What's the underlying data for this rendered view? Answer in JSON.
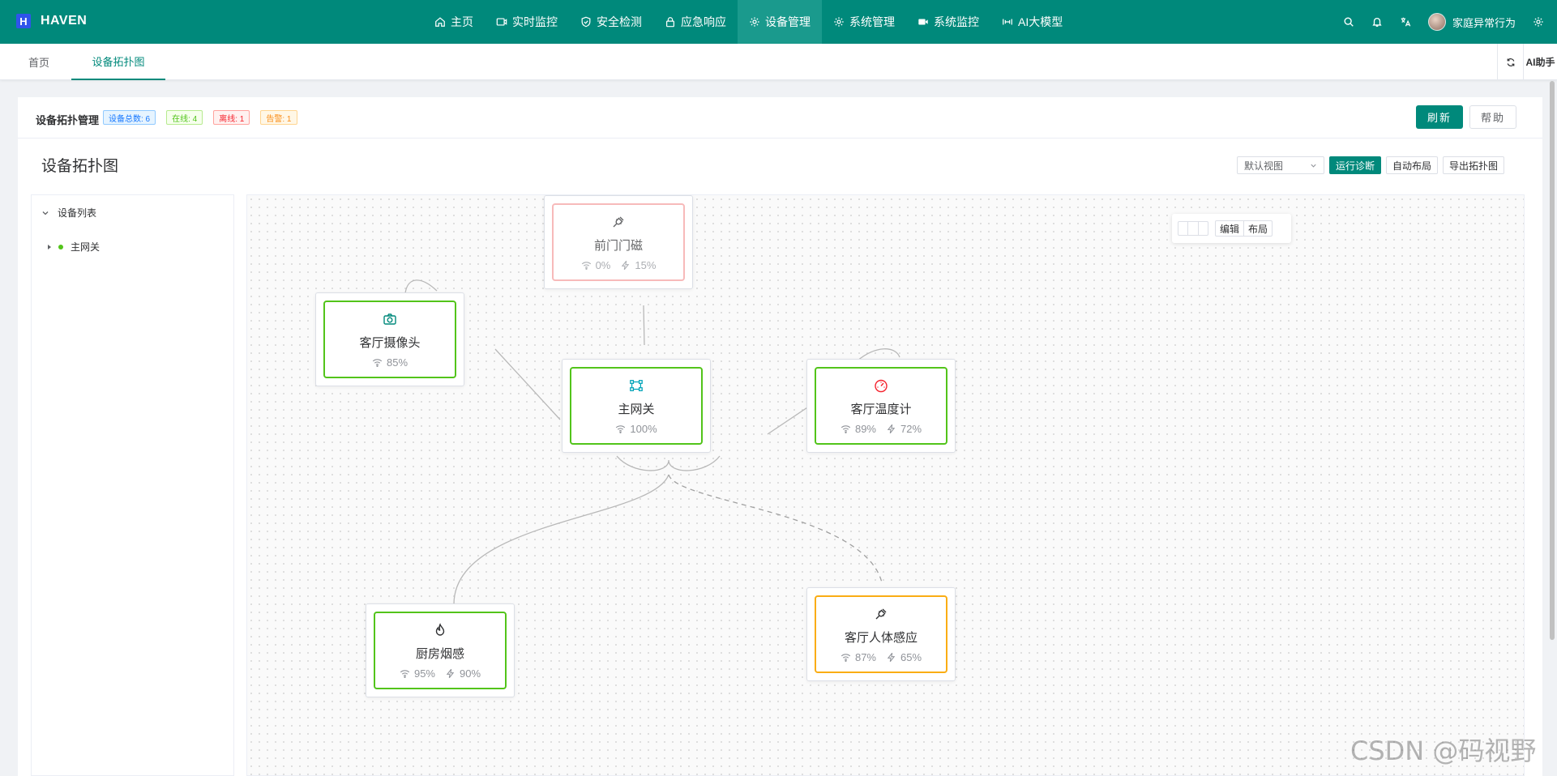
{
  "app": {
    "logo_letter": "H",
    "name": "HAVEN"
  },
  "nav": {
    "items": [
      {
        "label": "主页",
        "icon": "home-icon"
      },
      {
        "label": "实时监控",
        "icon": "video-icon"
      },
      {
        "label": "安全检测",
        "icon": "shield-icon"
      },
      {
        "label": "应急响应",
        "icon": "lock-icon"
      },
      {
        "label": "设备管理",
        "icon": "gear-icon",
        "active": true
      },
      {
        "label": "系统管理",
        "icon": "gear-icon"
      },
      {
        "label": "系统监控",
        "icon": "camera-icon"
      },
      {
        "label": "AI大模型",
        "icon": "ai-icon"
      }
    ]
  },
  "user": {
    "name": "家庭异常行为"
  },
  "tabs": {
    "home": "首页",
    "topology": "设备拓扑图"
  },
  "assistant": {
    "label": "AI助手"
  },
  "header": {
    "title": "设备拓扑管理",
    "tags": {
      "total": "设备总数: 6",
      "online": "在线: 4",
      "offline": "离线: 1",
      "alarm": "告警: 1"
    },
    "refresh_label": "刷新",
    "help_label": "帮助"
  },
  "topology": {
    "title": "设备拓扑图",
    "view_select": "默认视图",
    "diagnose_label": "运行诊断",
    "auto_layout_label": "自动布局",
    "export_label": "导出拓扑图"
  },
  "tree": {
    "root_label": "设备列表",
    "nodes": [
      {
        "label": "主网关",
        "status": "online"
      }
    ]
  },
  "canvas_tools": {
    "edit_label": "编辑",
    "layout_label": "布局"
  },
  "devices": [
    {
      "id": "door",
      "name": "前门门磁",
      "icon": "plug-icon",
      "status": "offline",
      "signal": "0%",
      "battery": "15%"
    },
    {
      "id": "camera",
      "name": "客厅摄像头",
      "icon": "camera-icon",
      "status": "online",
      "signal": "85%"
    },
    {
      "id": "gateway",
      "name": "主网关",
      "icon": "gateway-icon",
      "status": "online",
      "signal": "100%"
    },
    {
      "id": "thermo",
      "name": "客厅温度计",
      "icon": "gauge-icon",
      "status": "online",
      "signal": "89%",
      "battery": "72%"
    },
    {
      "id": "smoke",
      "name": "厨房烟感",
      "icon": "flame-icon",
      "status": "online",
      "signal": "95%",
      "battery": "90%"
    },
    {
      "id": "motion",
      "name": "客厅人体感应",
      "icon": "plug-icon",
      "status": "alarm",
      "signal": "87%",
      "battery": "65%"
    }
  ],
  "colors": {
    "primary": "#00897b",
    "online": "#52c41a",
    "offline": "#f5a3a3",
    "alarm": "#faad14"
  },
  "watermark": "CSDN @码视野"
}
